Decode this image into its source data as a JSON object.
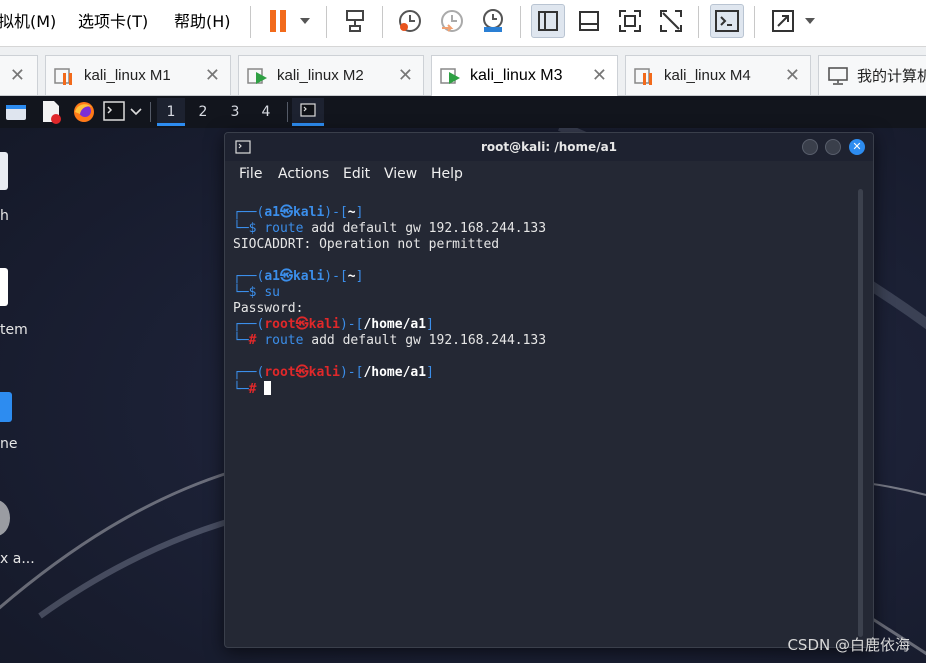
{
  "menubar": {
    "items": [
      "拟机(M)",
      "选项卡(T)",
      "帮助(H)"
    ]
  },
  "tabs": [
    {
      "label": "kali_linux M1",
      "state": "suspended"
    },
    {
      "label": "kali_linux M2",
      "state": "running"
    },
    {
      "label": "kali_linux M3",
      "state": "running",
      "active": true
    },
    {
      "label": "kali_linux M4",
      "state": "suspended"
    },
    {
      "label": "我的计算机"
    }
  ],
  "panel": {
    "workspaces": [
      "1",
      "2",
      "3",
      "4"
    ],
    "active_workspace": "1"
  },
  "desktop_labels": [
    "h",
    "tem",
    "ne",
    "x a..."
  ],
  "terminal": {
    "title": "root@kali: /home/a1",
    "menu": [
      "File",
      "Actions",
      "Edit",
      "View",
      "Help"
    ],
    "lines": {
      "l1_user": "a1",
      "l1_host": "kali",
      "l1_dir": "~",
      "l2_cmd": "route",
      "l2_args": " add default gw 192.168.244.133",
      "l3": "SIOCADDRT: Operation not permitted",
      "l5_user": "a1",
      "l5_host": "kali",
      "l5_dir": "~",
      "l6_cmd": "su",
      "l7": "Password:",
      "l8_user": "root",
      "l8_host": "kali",
      "l8_dir": "/home/a1",
      "l9_cmd": "route",
      "l9_args": " add default gw 192.168.244.133",
      "l11_user": "root",
      "l11_host": "kali",
      "l11_dir": "/home/a1"
    }
  },
  "watermark": "CSDN @白鹿依海",
  "colors": {
    "prompt_blue": "#3b8eea",
    "prompt_red": "#e0282a",
    "accent": "#2d8cf0"
  }
}
